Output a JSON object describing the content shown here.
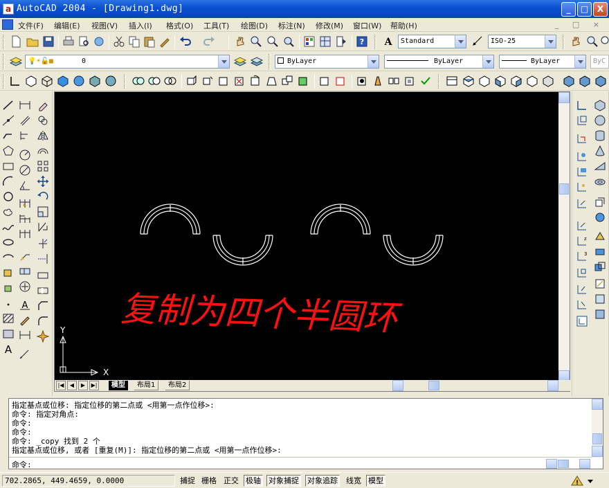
{
  "window": {
    "title": "AutoCAD 2004 - [Drawing1.dwg]",
    "minimize": "_",
    "maximize": "□",
    "close": "X"
  },
  "menu": {
    "items": [
      "文件(F)",
      "编辑(E)",
      "视图(V)",
      "插入(I)",
      "格式(O)",
      "工具(T)",
      "绘图(D)",
      "标注(N)",
      "修改(M)",
      "窗口(W)",
      "帮助(H)"
    ],
    "mdi_controls": "_ □ ×"
  },
  "toolbar_standard": {
    "text_style": "Standard",
    "dim_style": "ISO-25"
  },
  "toolbar_layers": {
    "layer": "0",
    "color": "ByLayer",
    "linetype": "ByLayer",
    "lineweight": "ByLayer",
    "plotstyle": "ByC"
  },
  "drawing": {
    "annotation": "复制为四个半圆环",
    "ucs_x": "X",
    "ucs_y": "Y"
  },
  "layout_tabs": [
    "模型",
    "布局1",
    "布局2"
  ],
  "command_history": [
    "指定基点或位移: 指定位移的第二点或 <用第一点作位移>:",
    "命令: 指定对角点:",
    "命令:",
    "命令:",
    "命令: _copy 找到 2 个",
    "指定基点或位移, 或者 [重复(M)]: 指定位移的第二点或 <用第一点作位移>:"
  ],
  "command_prompt": "命令:",
  "status": {
    "coords": "702.2865, 449.4659, 0.0000",
    "toggles": [
      {
        "label": "捕捉",
        "on": false
      },
      {
        "label": "栅格",
        "on": false
      },
      {
        "label": "正交",
        "on": false
      },
      {
        "label": "极轴",
        "on": true
      },
      {
        "label": "对象捕捉",
        "on": true
      },
      {
        "label": "对象追踪",
        "on": true
      },
      {
        "label": "线宽",
        "on": false
      },
      {
        "label": "模型",
        "on": true
      }
    ]
  },
  "colors": {
    "annotation": "#ff1010",
    "canvas": "#000000",
    "title_bar": "#0a4fd0"
  }
}
